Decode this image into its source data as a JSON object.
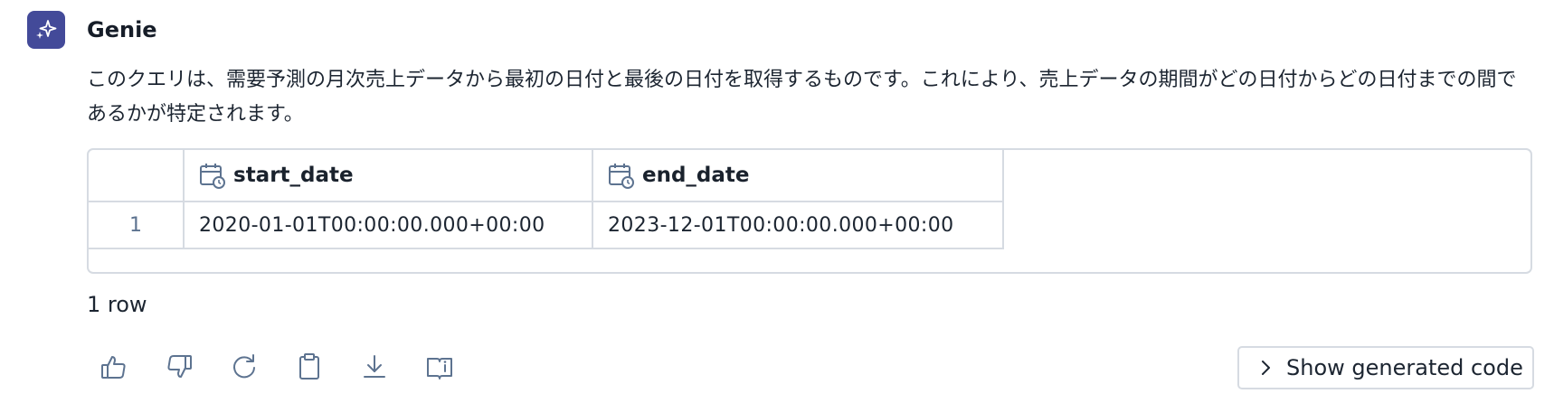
{
  "message": {
    "sender": "Genie",
    "text": "このクエリは、需要予測の月次売上データから最初の日付と最後の日付を取得するものです。これにより、売上データの期間がどの日付からどの日付までの間であるかが特定されます。"
  },
  "table": {
    "columns": [
      {
        "name": "start_date",
        "icon": "calendar-clock-icon"
      },
      {
        "name": "end_date",
        "icon": "calendar-clock-icon"
      }
    ],
    "rows": [
      {
        "index": "1",
        "start_date": "2020-01-01T00:00:00.000+00:00",
        "end_date": "2023-12-01T00:00:00.000+00:00"
      }
    ]
  },
  "row_count": "1 row",
  "actions": [
    "thumbs-up-icon",
    "thumbs-down-icon",
    "refresh-icon",
    "clipboard-icon",
    "download-icon",
    "book-info-icon"
  ],
  "code_button": {
    "label": "Show generated code",
    "icon": "chevron-right-icon"
  },
  "colors": {
    "avatar": "#434a99",
    "border": "#d6dbe2",
    "icon": "#5d7390"
  }
}
